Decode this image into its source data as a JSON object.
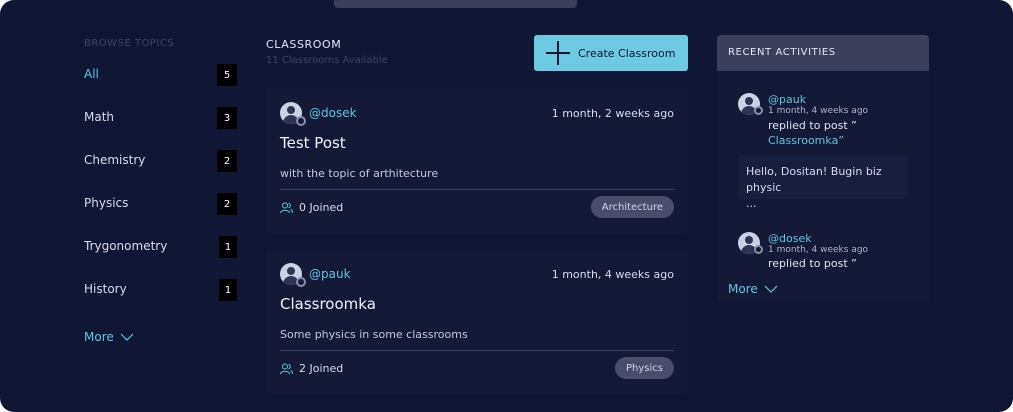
{
  "sidebar": {
    "title": "BROWSE TOPICS",
    "topics": [
      {
        "label": "All",
        "count": "5"
      },
      {
        "label": "Math",
        "count": "3"
      },
      {
        "label": "Chemistry",
        "count": "2"
      },
      {
        "label": "Physics",
        "count": "2"
      },
      {
        "label": "Trygonometry",
        "count": "1"
      },
      {
        "label": "History",
        "count": "1"
      }
    ],
    "more_label": "More"
  },
  "main": {
    "title": "CLASSROOM",
    "subtitle": "11 Classrooms Available",
    "create_button": "Create Classroom",
    "cards": [
      {
        "user": "@dosek",
        "time": "1 month, 2 weeks ago",
        "title": "Test Post",
        "description": "with the topic of arthitecture",
        "joined": "0 Joined",
        "tag": "Architecture"
      },
      {
        "user": "@pauk",
        "time": "1 month, 4 weeks ago",
        "title": "Classroomka",
        "description": "Some physics in some classrooms",
        "joined": "2 Joined",
        "tag": "Physics"
      }
    ]
  },
  "activity": {
    "title": "RECENT ACTIVITIES",
    "items": [
      {
        "user": "@pauk",
        "time": "1 month, 4 weeks ago",
        "action": "replied to post ”",
        "post": "Classroomka”",
        "message": "Hello, Dositan! Bugin biz physic\n..."
      },
      {
        "user": "@dosek",
        "time": "1 month, 4 weeks ago",
        "action": "replied to post ”"
      }
    ],
    "more_label": "More"
  },
  "colors": {
    "background": "#0f1735",
    "card": "#141a36",
    "accent": "#5fc4e3",
    "button": "#6ec9e3",
    "header": "#3b3f5a"
  }
}
